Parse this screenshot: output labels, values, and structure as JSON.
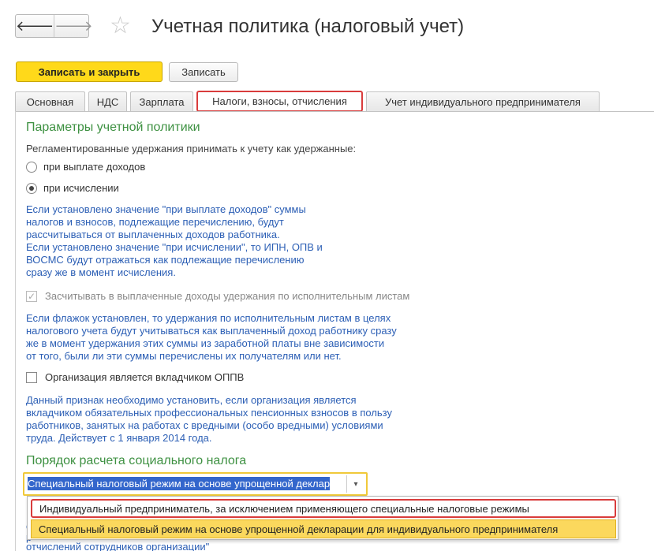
{
  "header": {
    "back_glyph": "🡐",
    "forward_glyph": "🡒",
    "star_glyph": "☆",
    "title": "Учетная политика (налоговый учет)"
  },
  "toolbar": {
    "save_close_label": "Записать и закрыть",
    "save_label": "Записать"
  },
  "tabs": [
    {
      "label": "Основная"
    },
    {
      "label": "НДС"
    },
    {
      "label": "Зарплата"
    },
    {
      "label": "Налоги, взносы, отчисления"
    },
    {
      "label": "Учет индивидуального предпринимателя"
    }
  ],
  "section1": {
    "title": "Параметры учетной политики",
    "retentions_label": "Регламентированные удержания принимать к учету как удержанные:",
    "radio_payment": "при выплате доходов",
    "radio_calc": "при исчислении",
    "hint1": [
      "Если установлено значение \"при выплате доходов\" суммы",
      "налогов и взносов, подлежащие перечислению, будут",
      "рассчитываться от выплаченных доходов работника.",
      "Если установлено значение \"при исчислении\", то ИПН, ОПВ и",
      "ВОСМС будут отражаться как подлежащие перечислению",
      "сразу же в момент исчисления."
    ],
    "check_exec_label": "Засчитывать в выплаченные доходы удержания по исполнительным листам",
    "check_mark": "✓",
    "hint2": [
      "Если флажок установлен, то удержания по исполнительным листам в целях",
      "налогового учета будут учитываться как выплаченный доход работнику сразу",
      "же в момент удержания этих суммы из заработной платы вне зависимости",
      "от того, были ли эти суммы перечислены их получателям или нет."
    ],
    "check_oppv_label": "Организация является вкладчиком ОППВ",
    "hint3": [
      "Данный признак необходимо установить, если организация является",
      "вкладчиком обязательных профессиональных пенсионных взносов в пользу",
      "работников, занятых на работах с вредными (особо вредными) условиями",
      "труда. Действует с 1 января 2014 года."
    ]
  },
  "section2": {
    "title": "Порядок расчета социального налога",
    "combo_value": "Специальный налоговый режим на основе упрощенной деклар",
    "combo_arrow": "▾",
    "dropdown_options": [
      "Индивидуальный предприниматель, за исключением применяющего специальные налоговые режимы",
      "Специальный налоговый режим на основе упрощенной декларации для индивидуального предпринимателя"
    ],
    "under_fragments": [
      "Г",
      "с",
      "р",
      "отчислений сотрудников организации\""
    ]
  }
}
